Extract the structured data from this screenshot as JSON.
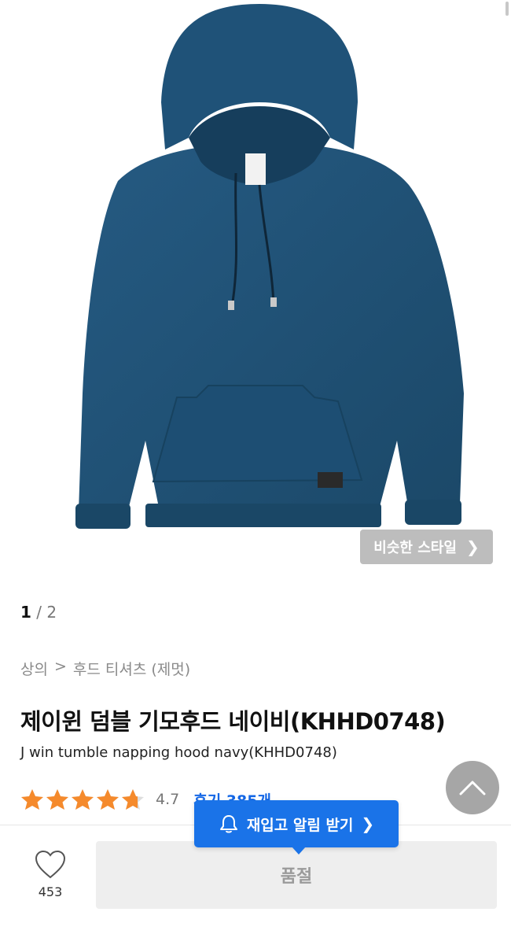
{
  "gallery": {
    "similar_label": "비슷한 스타일",
    "page_current": "1",
    "page_sep": " / ",
    "page_total": "2"
  },
  "breadcrumb": {
    "category": "상의",
    "sep": ">",
    "subcategory": "후드 티셔츠 (제멋)"
  },
  "product": {
    "title": "제이윈 덤블 기모후드 네이비(KHHD0748)",
    "subtitle": "J win tumble napping hood navy(KHHD0748)",
    "rating": "4.7",
    "rating_stars": 4.7,
    "review_label": "후기 385개",
    "color": "#1e4f73"
  },
  "actions": {
    "restock_label": "재입고 알림 받기",
    "like_count": "453",
    "soldout_label": "품절"
  },
  "colors": {
    "accent": "#1a73e8",
    "star": "#f58a2c"
  }
}
